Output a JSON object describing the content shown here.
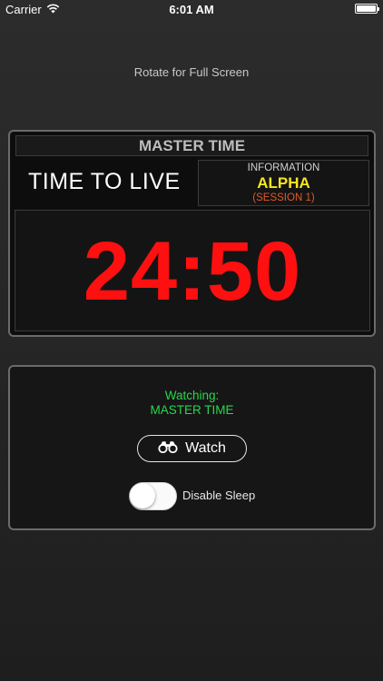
{
  "status_bar": {
    "carrier": "Carrier",
    "time": "6:01 AM",
    "wifi_icon": "wifi-icon",
    "battery_icon": "battery-full-icon"
  },
  "rotate_hint": "Rotate for Full Screen",
  "master": {
    "title": "MASTER TIME",
    "session_name": "TIME TO LIVE",
    "info": {
      "label": "INFORMATION",
      "value": "ALPHA",
      "sub": "(SESSION 1)"
    },
    "time_value": "24:50"
  },
  "watch": {
    "label": "Watching:",
    "value": "MASTER TIME",
    "button_label": "Watch",
    "button_icon": "binoculars-icon",
    "toggle_label": "Disable Sleep",
    "toggle_on": false
  },
  "colors": {
    "time_red": "#ff1010",
    "alpha_yellow": "#f7e61e",
    "session_orange": "#e05a28",
    "watching_green": "#27d84a"
  }
}
